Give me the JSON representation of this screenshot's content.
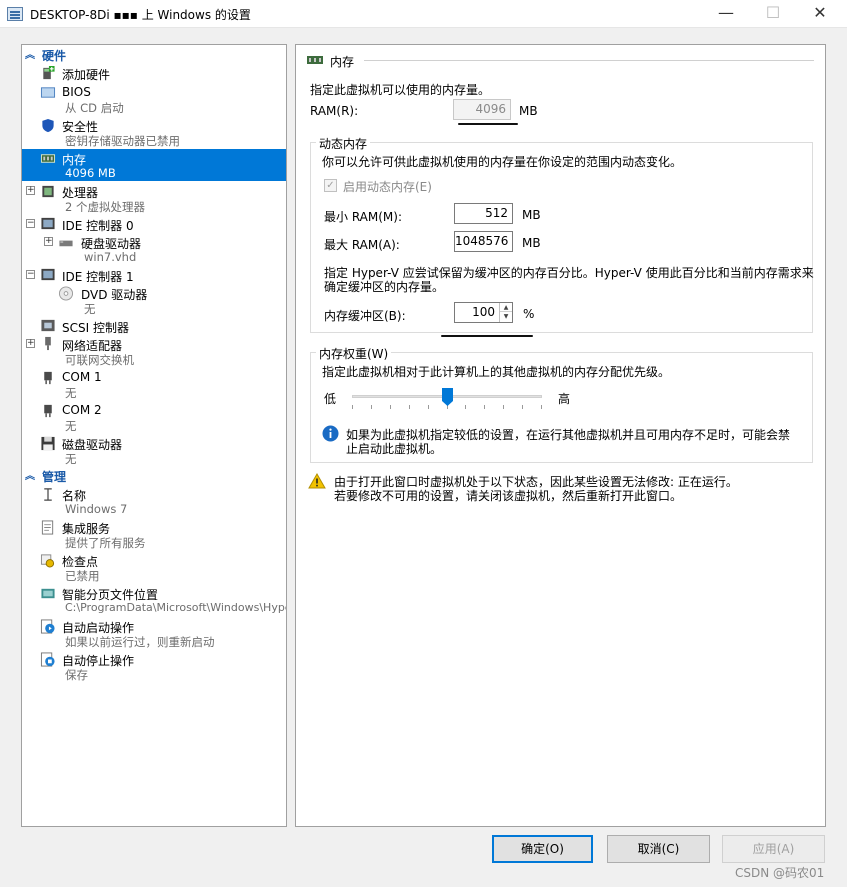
{
  "window": {
    "title": "DESKTOP-8Di  ▪▪▪  上 Windows     的设置",
    "minimize": "—",
    "maximize": "☐",
    "close": "✕"
  },
  "tree": {
    "hardware_header": "硬件",
    "management_header": "管理",
    "items": [
      {
        "label": "添加硬件",
        "sub": ""
      },
      {
        "label": "BIOS",
        "sub": "从 CD 启动"
      },
      {
        "label": "安全性",
        "sub": "密钥存储驱动器已禁用"
      },
      {
        "label": "内存",
        "sub": "4096 MB"
      },
      {
        "label": "处理器",
        "sub": "2 个虚拟处理器"
      },
      {
        "label": "IDE 控制器 0",
        "sub": ""
      },
      {
        "label": "硬盘驱动器",
        "sub": "win7.vhd"
      },
      {
        "label": "IDE 控制器 1",
        "sub": ""
      },
      {
        "label": "DVD 驱动器",
        "sub": "无"
      },
      {
        "label": "SCSI 控制器",
        "sub": ""
      },
      {
        "label": "网络适配器",
        "sub": "可联网交换机"
      },
      {
        "label": "COM 1",
        "sub": "无"
      },
      {
        "label": "COM 2",
        "sub": "无"
      },
      {
        "label": "磁盘驱动器",
        "sub": "无"
      }
    ],
    "mgmt_items": [
      {
        "label": "名称",
        "sub": "Windows 7"
      },
      {
        "label": "集成服务",
        "sub": "提供了所有服务"
      },
      {
        "label": "检查点",
        "sub": "已禁用"
      },
      {
        "label": "智能分页文件位置",
        "sub": "C:\\ProgramData\\Microsoft\\Windows\\Hyper-V"
      },
      {
        "label": "自动启动操作",
        "sub": "如果以前运行过，则重新启动"
      },
      {
        "label": "自动停止操作",
        "sub": "保存"
      }
    ]
  },
  "memory": {
    "header": "内存",
    "intro": "指定此虚拟机可以使用的内存量。",
    "ram_label": "RAM(R):",
    "ram_value": "4096",
    "unit_mb": "MB",
    "dynamic": {
      "title": "动态内存",
      "desc": "你可以允许可供此虚拟机使用的内存量在你设定的范围内动态变化。",
      "checkbox_label": "启用动态内存(E)",
      "checkbox_checked": true,
      "min_label": "最小 RAM(M):",
      "min_value": "512",
      "max_label": "最大 RAM(A):",
      "max_value": "1048576",
      "buffer_desc_1": "指定 Hyper-V 应尝试保留为缓冲区的内存百分比。Hyper-V 使用此百分比和当前内存需求来",
      "buffer_desc_2": "确定缓冲区的内存量。",
      "buffer_label": "内存缓冲区(B):",
      "buffer_value": "100",
      "percent": "%"
    },
    "weight": {
      "title": "内存权重(W)",
      "desc": "指定此虚拟机相对于此计算机上的其他虚拟机的内存分配优先级。",
      "low": "低",
      "high": "高",
      "slider_level": 0.5,
      "info_1": "如果为此虚拟机指定较低的设置，在运行其他虚拟机并且可用内存不足时，可能会禁",
      "info_2": "止启动此虚拟机。"
    },
    "warning_1": "由于打开此窗口时虚拟机处于以下状态，因此某些设置无法修改: 正在运行。",
    "warning_2": "若要修改不可用的设置，请关闭该虚拟机，然后重新打开此窗口。"
  },
  "buttons": {
    "ok": "确定(O)",
    "cancel": "取消(C)",
    "apply": "应用(A)"
  },
  "watermark": "CSDN @码农01",
  "colors": {
    "accent": "#0078d7",
    "section_header": "#1a5aa8",
    "info_icon": "#1a6bc4",
    "warning_icon": "#f2c200"
  }
}
